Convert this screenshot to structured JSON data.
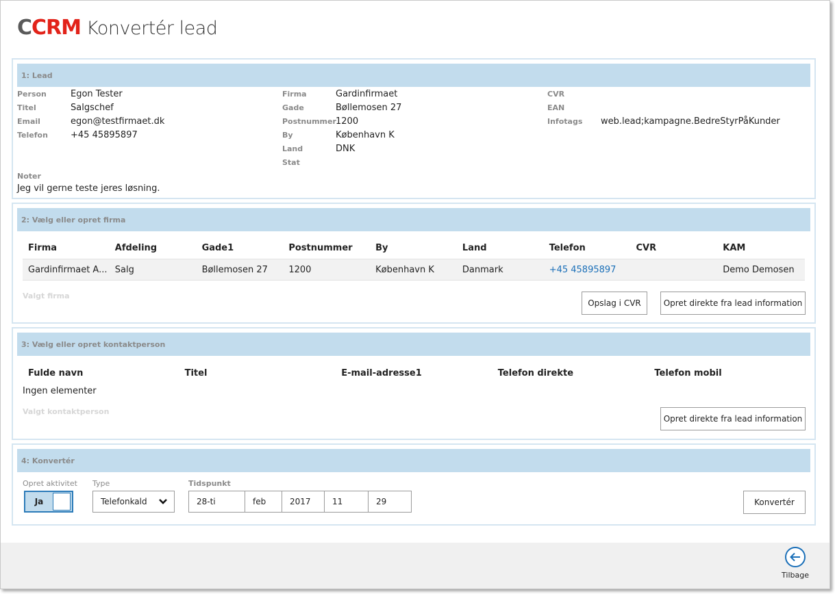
{
  "header": {
    "logo_c": "C",
    "logo_crm": "CRM",
    "title": "Konvertér lead"
  },
  "lead": {
    "heading": "1: Lead",
    "col1": [
      {
        "label": "Person",
        "value": "Egon Tester"
      },
      {
        "label": "Titel",
        "value": "Salgschef"
      },
      {
        "label": "Email",
        "value": "egon@testfirmaet.dk"
      },
      {
        "label": "Telefon",
        "value": "+45 45895897"
      }
    ],
    "col2": [
      {
        "label": "Firma",
        "value": "Gardinfirmaet"
      },
      {
        "label": "Gade",
        "value": "Bøllemosen 27"
      },
      {
        "label": "Postnummer",
        "value": "1200"
      },
      {
        "label": "By",
        "value": "København K"
      },
      {
        "label": "Land",
        "value": "DNK"
      },
      {
        "label": "Stat",
        "value": ""
      }
    ],
    "col3": [
      {
        "label": "CVR",
        "value": ""
      },
      {
        "label": "EAN",
        "value": ""
      },
      {
        "label": "Infotags",
        "value": "web.lead;kampagne.BedreStyrPåKunder"
      }
    ],
    "notes_label": "Noter",
    "notes_value": "Jeg vil gerne teste jeres løsning."
  },
  "company": {
    "heading": "2: Vælg eller opret firma",
    "columns": [
      "Firma",
      "Afdeling",
      "Gade1",
      "Postnummer",
      "By",
      "Land",
      "Telefon",
      "CVR",
      "KAM"
    ],
    "rows": [
      [
        "Gardinfirmaet A...",
        "Salg",
        "Bøllemosen 27",
        "1200",
        "København K",
        "Danmark",
        "+45 45895897",
        "",
        "Demo Demosen"
      ]
    ],
    "selected_label": "Valgt firma",
    "btn_lookup": "Opslag i CVR",
    "btn_create": "Opret direkte fra lead information"
  },
  "contact": {
    "heading": "3: Vælg eller opret kontaktperson",
    "columns": [
      "Fulde navn",
      "Titel",
      "E-mail-adresse1",
      "Telefon direkte",
      "Telefon mobil"
    ],
    "empty_text": "Ingen elementer",
    "selected_label": "Valgt kontaktperson",
    "btn_create": "Opret direkte fra lead information"
  },
  "convert": {
    "heading": "4: Konvertér",
    "activity_label": "Opret aktivitet",
    "toggle_value": "Ja",
    "type_label": "Type",
    "type_value": "Telefonkald",
    "time_label": "Tidspunkt",
    "time_day": "28-ti",
    "time_month": "feb",
    "time_year": "2017",
    "time_hour": "11",
    "time_minute": "29",
    "btn_convert": "Konvertér"
  },
  "footer": {
    "back_label": "Tilbage"
  },
  "colors": {
    "section_header": "#c2dced",
    "accent": "#2a7ab8",
    "link": "#1a6fb8",
    "logo_red": "#e2231a"
  }
}
